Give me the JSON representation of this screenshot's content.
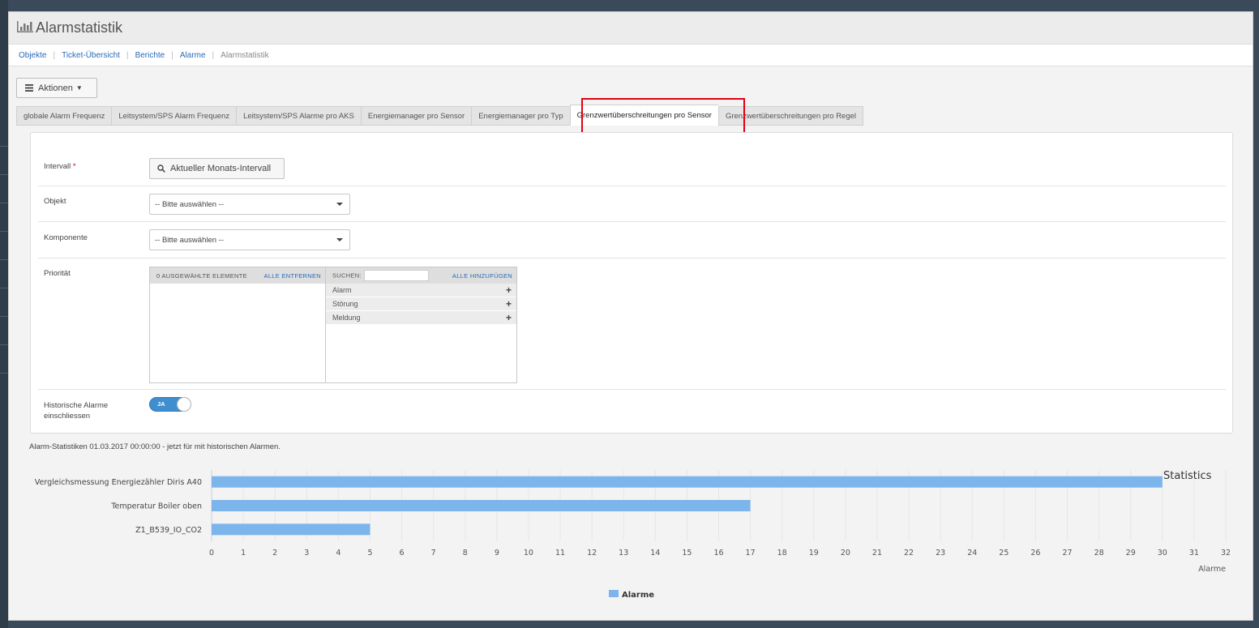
{
  "header": {
    "title": "Alarmstatistik",
    "icon": "bar-chart-icon"
  },
  "breadcrumb": {
    "items": [
      "Objekte",
      "Ticket-Übersicht",
      "Berichte",
      "Alarme"
    ],
    "current": "Alarmstatistik"
  },
  "actions": {
    "label": "Aktionen"
  },
  "tabs": [
    "globale Alarm Frequenz",
    "Leitsystem/SPS Alarm Frequenz",
    "Leitsystem/SPS Alarme pro AKS",
    "Energiemanager pro Sensor",
    "Energiemanager pro Typ",
    "Grenzwertüberschreitungen pro Sensor",
    "Grenzwertüberschreitungen pro Regel"
  ],
  "active_tab": 5,
  "form": {
    "intervall": {
      "label": "Intervall",
      "required_mark": "*",
      "button": "Aktueller Monats-Intervall"
    },
    "objekt": {
      "label": "Objekt",
      "value": "-- Bitte auswählen --"
    },
    "komponente": {
      "label": "Komponente",
      "value": "-- Bitte auswählen --"
    },
    "prioritaet": {
      "label": "Priorität",
      "selected_header": "0 AUSGEWÄHLTE ELEMENTE",
      "remove_all": "ALLE ENTFERNEN",
      "search_label": "SUCHEN:",
      "add_all": "ALLE HINZUFÜGEN",
      "options": [
        "Alarm",
        "Störung",
        "Meldung"
      ]
    },
    "historisch": {
      "label_line1": "Historische Alarme",
      "label_line2": "einschliessen",
      "toggle": "JA"
    }
  },
  "stat_text": "Alarm-Statistiken 01.03.2017 00:00:00 - jetzt für mit historischen Alarmen.",
  "colors": {
    "bar": "#7cb5ec",
    "accent": "#3e8ed0",
    "highlight": "#e3000f"
  },
  "chart_data": {
    "type": "bar",
    "orientation": "horizontal",
    "title": "Statistics",
    "categories": [
      "Vergleichsmessung Energiezähler Diris A40",
      "Temperatur Boiler oben",
      "Z1_B539_IO_CO2"
    ],
    "series": [
      {
        "name": "Alarme",
        "values": [
          30,
          17,
          5
        ]
      }
    ],
    "xlabel": "Alarme",
    "xlim": [
      0,
      32
    ],
    "xticks": [
      0,
      1,
      2,
      3,
      4,
      5,
      6,
      7,
      8,
      9,
      10,
      11,
      12,
      13,
      14,
      15,
      16,
      17,
      18,
      19,
      20,
      21,
      22,
      23,
      24,
      25,
      26,
      27,
      28,
      29,
      30,
      31,
      32
    ],
    "grid": true,
    "legend": "bottom-center"
  }
}
